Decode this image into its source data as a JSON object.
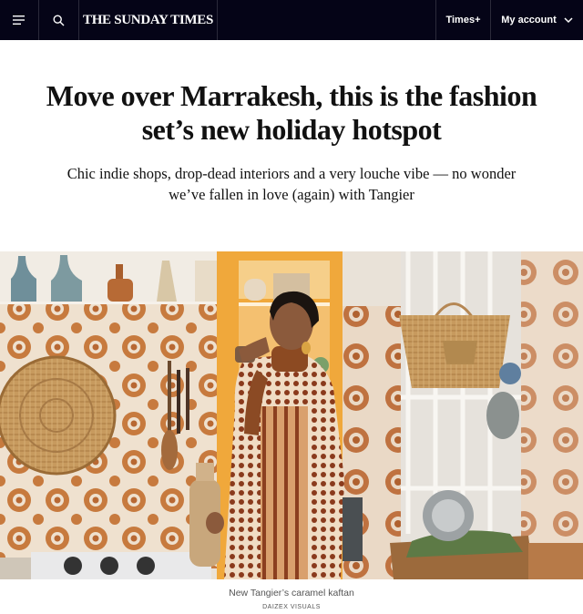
{
  "nav": {
    "menu_icon": "hamburger-menu-icon",
    "search_icon": "search-icon",
    "masthead": "THE SUNDAY TIMES",
    "times_plus": "Times+",
    "account": "My account",
    "account_icon": "chevron-down-icon"
  },
  "article": {
    "headline": "Move over Marrakesh, this is the fashion set’s new holiday hotspot",
    "standfirst": "Chic indie shops, drop-dead interiors and a very louche vibe — no wonder we’ve fallen in love (again) with Tangier"
  },
  "image": {
    "caption": "New Tangier’s caramel kaftan",
    "credit": "DAIZEX VISUALS"
  }
}
